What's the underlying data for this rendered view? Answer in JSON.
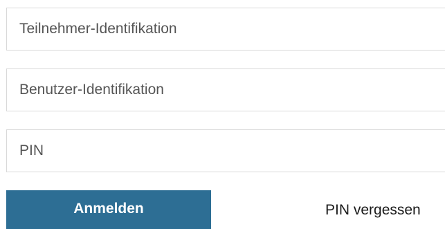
{
  "form": {
    "participant_id": {
      "placeholder": "Teilnehmer-Identifikation",
      "value": ""
    },
    "user_id": {
      "placeholder": "Benutzer-Identifikation",
      "value": ""
    },
    "pin": {
      "placeholder": "PIN",
      "value": ""
    },
    "login_label": "Anmelden",
    "forgot_pin_label": "PIN vergessen"
  },
  "colors": {
    "button_bg": "#2d6e94",
    "button_text": "#ffffff",
    "field_border": "#d9d9d9",
    "placeholder_text": "#555555"
  }
}
